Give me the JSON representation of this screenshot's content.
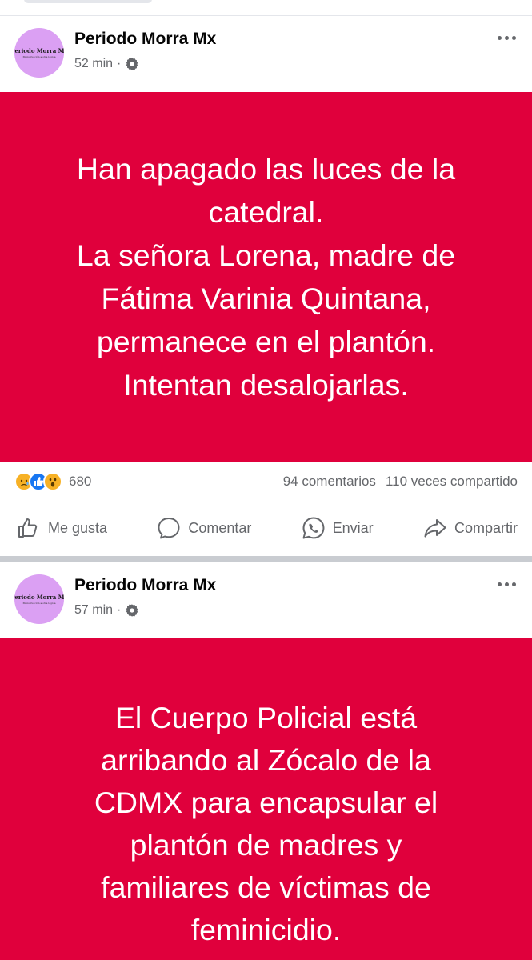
{
  "feed": {
    "posts": [
      {
        "author": "Periodo Morra Mx",
        "avatar_logo_text": "Periodo Morra Mx",
        "avatar_tagline": "Menstruación a otra lógica",
        "time": "52 min",
        "separator": "·",
        "audience_icon": "gear-icon",
        "background_color": "#e0003c",
        "text": "Han apagado las luces de la\ncatedral.\nLa señora Lorena, madre de\nFátima Varinia Quintana,\npermanece en el plantón.\nIntentan desalojarlas.",
        "reactions": {
          "icons": [
            "sad-reaction-icon",
            "like-reaction-icon",
            "wow-reaction-icon"
          ],
          "count": "680",
          "comments": "94 comentarios",
          "shares": "110 veces compartido"
        },
        "actions": {
          "like": "Me gusta",
          "comment": "Comentar",
          "send": "Enviar",
          "share": "Compartir"
        }
      },
      {
        "author": "Periodo Morra Mx",
        "avatar_logo_text": "Periodo Morra Mx",
        "avatar_tagline": "Menstruación a otra lógica",
        "time": "57 min",
        "separator": "·",
        "audience_icon": "gear-icon",
        "background_color": "#e0003c",
        "text": "El Cuerpo Policial está\narribando al Zócalo de la\nCDMX para encapsular el\nplantón de madres y\nfamiliares de víctimas de\nfeminicidio."
      }
    ]
  }
}
